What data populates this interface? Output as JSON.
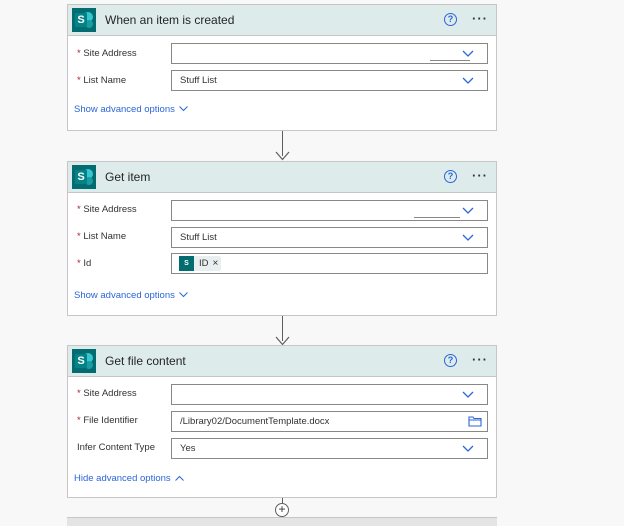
{
  "cards": [
    {
      "title": "When an item is created",
      "help": "?",
      "more": "···",
      "fields": [
        {
          "label": "Site Address",
          "required": "*",
          "value": ""
        },
        {
          "label": "List Name",
          "required": "*",
          "value": "Stuff List"
        }
      ],
      "advanced_link": "Show advanced options"
    },
    {
      "title": "Get item",
      "help": "?",
      "more": "···",
      "fields": [
        {
          "label": "Site Address",
          "required": "*",
          "value": ""
        },
        {
          "label": "List Name",
          "required": "*",
          "value": "Stuff List"
        },
        {
          "label": "Id",
          "required": "*",
          "token": "ID",
          "token_remove": "×"
        }
      ],
      "advanced_link": "Show advanced options"
    },
    {
      "title": "Get file content",
      "help": "?",
      "more": "···",
      "fields": [
        {
          "label": "Site Address",
          "required": "*",
          "value": ""
        },
        {
          "label": "File Identifier",
          "required": "*",
          "value": "/Library02/DocumentTemplate.docx"
        },
        {
          "label": "Infer Content Type",
          "value": "Yes"
        }
      ],
      "advanced_link": "Hide advanced options"
    }
  ],
  "connector_icon": "down-arrow-icon",
  "add_step": "+",
  "icons": {
    "app": "sharepoint-icon",
    "letter": "S",
    "chevron": "chevron-down-icon",
    "folder": "folder-icon"
  },
  "colors": {
    "header_bg": "#ddeceb",
    "accent": "#2b65d9",
    "sharepoint": "#036c70",
    "required": "#a4262c"
  }
}
